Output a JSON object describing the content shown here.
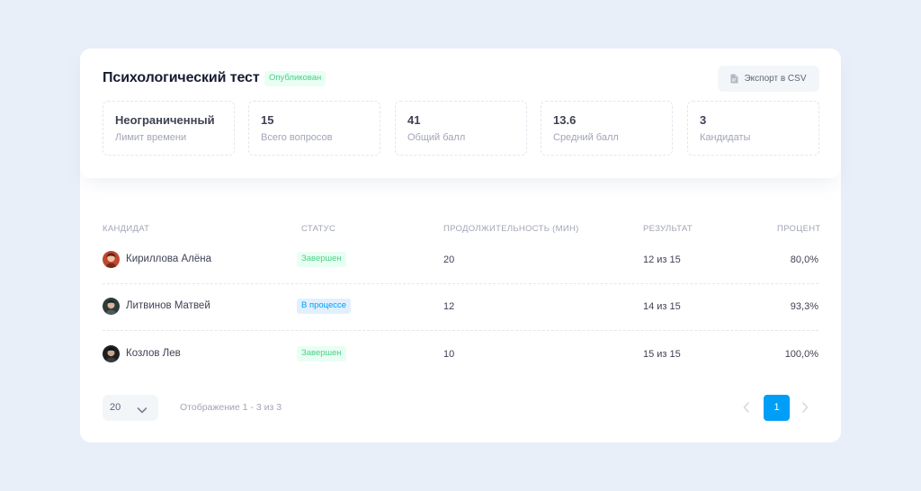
{
  "header": {
    "title": "Психологический тест",
    "status_badge": "Опубликован",
    "export_label": "Экспорт в CSV",
    "export_icon": "file-icon"
  },
  "stats": [
    {
      "value": "Неограниченный",
      "label": "Лимит времени"
    },
    {
      "value": "15",
      "label": "Всего вопросов"
    },
    {
      "value": "41",
      "label": "Общий балл"
    },
    {
      "value": "13.6",
      "label": "Средний балл"
    },
    {
      "value": "3",
      "label": "Кандидаты"
    }
  ],
  "table": {
    "headers": {
      "candidate": "КАНДИДАТ",
      "status": "СТАТУС",
      "duration": "ПРОДОЛЖИТЕЛЬНОСТЬ (МИН)",
      "result": "РЕЗУЛЬТАТ",
      "percent": "ПРОЦЕНТ"
    },
    "rows": [
      {
        "name": "Кириллова Алёна",
        "status": "Завершен",
        "status_color": "#50cd89",
        "duration": "20",
        "result": "12 из 15",
        "percent": "80,0%"
      },
      {
        "name": "Литвинов Матвей",
        "status": "В процессе",
        "status_color": "#009ef7",
        "duration": "12",
        "result": "14 из 15",
        "percent": "93,3%"
      },
      {
        "name": "Козлов Лев",
        "status": "Завершен",
        "status_color": "#50cd89",
        "duration": "10",
        "result": "15 из 15",
        "percent": "100,0%"
      }
    ]
  },
  "footer": {
    "per_page": "20",
    "showing": "Отображение 1 - 3 из 3",
    "current_page": "1"
  },
  "colors": {
    "accent": "#009ef7",
    "success": "#50cd89",
    "background": "#e9eff8"
  }
}
